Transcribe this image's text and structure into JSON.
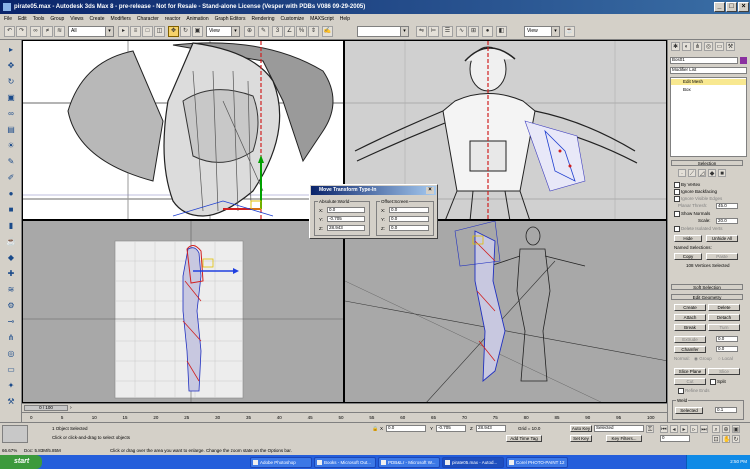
{
  "window": {
    "title": "pirate05.max - Autodesk 3ds Max 8 - pre-release - Not for Resale - Stand-alone License (Vesper with PDBs V086 09-29-2005)",
    "min_label": "_",
    "max_label": "□",
    "close_label": "×"
  },
  "menu": [
    "File",
    "Edit",
    "Tools",
    "Group",
    "Views",
    "Create",
    "Modifiers",
    "Character",
    "reactor",
    "Animation",
    "Graph Editors",
    "Rendering",
    "Customize",
    "MAXScript",
    "Help"
  ],
  "toolbar": {
    "selection_filter": "All",
    "ref_coord": "View",
    "named_selection": "",
    "view_combo": "View"
  },
  "viewports": {
    "top_left": {
      "colors": {
        "bg": "#ffffff"
      }
    },
    "top_right": {
      "colors": {
        "bg": "#d0d0d0"
      }
    },
    "bottom_left": {
      "colors": {
        "bg": "#a8a8a8"
      }
    },
    "bottom_right": {
      "colors": {
        "bg": "#a8a8a8"
      }
    }
  },
  "dialog": {
    "title": "Move Transform Type-In",
    "absolute_label": "Absolute:World",
    "offset_label": "Offset:Screen",
    "abs": {
      "x": "0.0",
      "y": "-0.705",
      "z": "28.943"
    },
    "off": {
      "x": "0.0",
      "y": "0.0",
      "z": "0.0"
    },
    "x_label": "X:",
    "y_label": "Y:",
    "z_label": "Z:"
  },
  "command_panel": {
    "object_name": "Bos01",
    "modifier_list": "Modifier List",
    "stack_item": "Edit Mesh",
    "stack_sub": "Box",
    "selection_head": "Selection",
    "by_vertex": "By Vertex",
    "ignore_backfacing": "Ignore Backfacing",
    "ignore_visible_edges": "Ignore Visible Edges",
    "planar_thresh_label": "Planar Thresh:",
    "planar_thresh": "45.0",
    "show_normals": "Show Normals",
    "scale_label": "Scale:",
    "scale": "20.0",
    "delete_isolated": "Delete Isolated Verts",
    "hide": "Hide",
    "unhide_all": "Unhide All",
    "named_selections": "Named Selections:",
    "copy": "Copy",
    "paste": "Paste",
    "vertices_selected": "108 Vertices Selected",
    "soft_selection": "Soft Selection",
    "edit_geometry": "Edit Geometry",
    "create": "Create",
    "delete": "Delete",
    "attach": "Attach",
    "detach": "Detach",
    "break": "Break",
    "turn": "Turn",
    "extrude": "Extrude",
    "extrude_val": "0.0",
    "chamfer": "Chamfer",
    "chamfer_val": "0.0",
    "normal": "Normal:",
    "group": "Group",
    "local": "Local",
    "slice_plane": "Slice Plane",
    "slice": "Slice",
    "cut": "Cut",
    "split": "Split",
    "refine_ends": "Refine Ends",
    "weld_head": "Weld",
    "selected": "Selected",
    "selected_val": "0.1"
  },
  "timeline": {
    "frame_label": "0 / 100",
    "ticks": [
      "0",
      "5",
      "10",
      "15",
      "20",
      "25",
      "30",
      "35",
      "40",
      "45",
      "50",
      "55",
      "60",
      "65",
      "70",
      "75",
      "80",
      "85",
      "90",
      "95",
      "100"
    ]
  },
  "status": {
    "objects_selected": "1 Object Selected",
    "prompt": "Click or click-and-drag to select objects",
    "x_label": "X",
    "x_val": "0.0",
    "y_label": "Y",
    "y_val": "-0.705",
    "z_label": "Z",
    "z_val": "28.943",
    "grid": "Grid = 10.0",
    "add_time_tag": "Add Time Tag",
    "auto_key": "Auto Key",
    "set_key": "Set Key",
    "key_mode": "Selected",
    "key_filters": "Key Filters...",
    "frame_val": "0",
    "info_left": "66.67%",
    "info_doc": "Doc: 5.83M/5.85M",
    "zoom_hint": "Click or drag over the area you want to enlarge. Change the zoom state on the Options bar."
  },
  "taskbar": {
    "start": "start",
    "tasks": [
      "Adobe Photoshop",
      "Books - Microsoft Out...",
      "PDB&Lr - Microsoft W...",
      "pirate05.max - Autod...",
      "Corel PHOTO-PAINT 12"
    ],
    "time": "2:50 PM"
  }
}
